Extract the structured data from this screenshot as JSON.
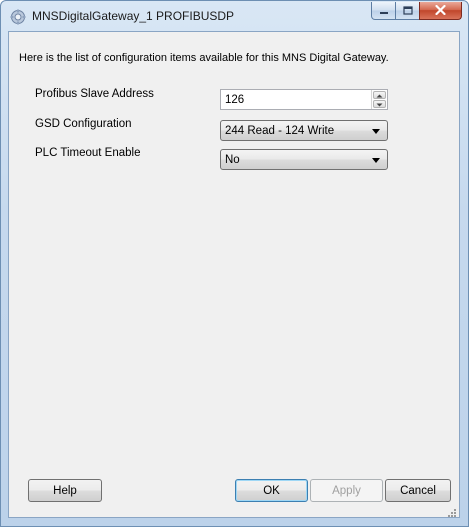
{
  "window": {
    "title": "MNSDigitalGateway_1 PROFIBUSDP",
    "icon": "gear-app-icon"
  },
  "caption_buttons": {
    "minimize_icon": "minimize-icon",
    "maximize_icon": "maximize-icon",
    "close_icon": "close-icon"
  },
  "main": {
    "intro": "Here is the list of configuration items available for this MNS Digital Gateway.",
    "fields": [
      {
        "label": "Profibus Slave Address",
        "value": "126",
        "control": "spin-box"
      },
      {
        "label": "GSD Configuration",
        "value": "244 Read - 124 Write",
        "control": "dropdown"
      },
      {
        "label": "PLC Timeout Enable",
        "value": "No",
        "control": "dropdown"
      }
    ]
  },
  "buttons": {
    "help": "Help",
    "ok": "OK",
    "apply": "Apply",
    "cancel": "Cancel"
  },
  "colors": {
    "titlebar": "#c6d9ee",
    "client_background": "#f0f0f0",
    "close_button": "#c0462b"
  }
}
